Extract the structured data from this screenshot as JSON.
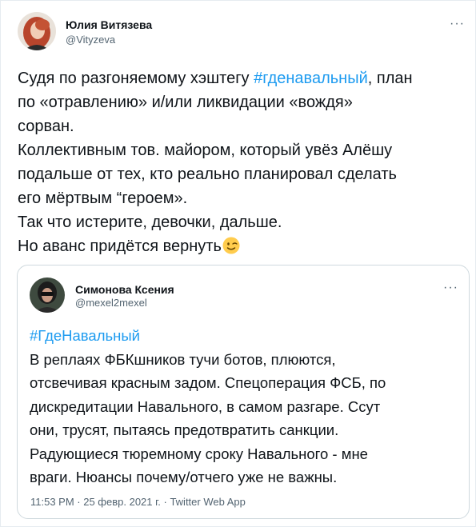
{
  "tweet": {
    "author_name": "Юлия Витязева",
    "author_handle": "@Vityzeva",
    "more_label": "···",
    "text_line1_pre": "Судя по разгоняемому хэштегу ",
    "text_line1_hashtag": "#гденавальный",
    "text_line1_post": ", план",
    "text_line2": "по «отравлению» и/или ликвидации «вождя»",
    "text_line3": "сорван.",
    "text_line4": "Коллективным тов. майором, который увёз Алёшу",
    "text_line5": "подальше от тех, кто реально планировал сделать",
    "text_line6": "его мёртвым “героем».",
    "text_line7": "Так что истерите, девочки, дальше.",
    "text_line8": "Но аванс придётся вернуть",
    "emoji": "winking-face"
  },
  "quoted_tweet": {
    "author_name": "Симонова Ксения",
    "author_handle": "@mexel2mexel",
    "more_label": "···",
    "hashtag": "#ГдеНавальный",
    "text_line1": "В реплаях ФБКшников тучи ботов, плюются,",
    "text_line2": "отсвечивая красным задом. Спецоперация ФСБ, по",
    "text_line3": "дискредитации Навального, в самом разгаре. Ссут",
    "text_line4": "они, трусят, пытаясь предотвратить санкции.",
    "text_line5": "Радующиеся тюремному сроку Навального - мне",
    "text_line6": "враги. Нюансы почему/отчего уже не важны.",
    "meta": "11:53 PM · 25 февр. 2021 г. · Twitter Web App"
  },
  "colors": {
    "link": "#1d9bf0",
    "text": "#0f1419",
    "secondary": "#536471",
    "border": "#cfd9de"
  }
}
